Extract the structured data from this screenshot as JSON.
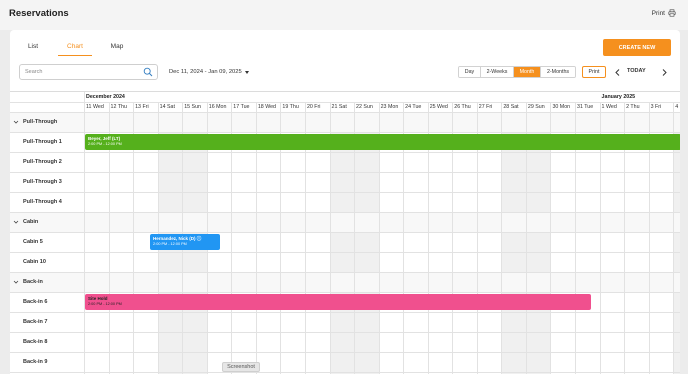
{
  "app": {
    "title": "Reservations",
    "print_label": "Print"
  },
  "tabs": [
    {
      "label": "List"
    },
    {
      "label": "Chart"
    },
    {
      "label": "Map"
    }
  ],
  "create_button": "CREATE NEW",
  "search": {
    "placeholder": "Search",
    "value": ""
  },
  "date_range": "Dec 11, 2024 - Jan 09, 2025",
  "view_buttons": [
    {
      "label": "Day"
    },
    {
      "label": "2-Weeks"
    },
    {
      "label": "Month"
    },
    {
      "label": "2-Months"
    }
  ],
  "active_view": "Month",
  "print_button": "Print",
  "today_button": "TODAY",
  "timeline": {
    "months": [
      {
        "label": "December 2024",
        "start_index": 0
      },
      {
        "label": "January 2025",
        "start_index": 21
      }
    ],
    "days": [
      "11 Wed",
      "12 Thu",
      "13 Fri",
      "14 Sat",
      "15 Sun",
      "16 Mon",
      "17 Tue",
      "18 Wed",
      "19 Thu",
      "20 Fri",
      "21 Sat",
      "22 Sun",
      "23 Mon",
      "24 Tue",
      "25 Wed",
      "26 Thu",
      "27 Fri",
      "28 Sat",
      "29 Sun",
      "30 Mon",
      "31 Tue",
      "1 Wed",
      "2 Thu",
      "3 Fri",
      "4"
    ],
    "weekend_indices": [
      3,
      4,
      10,
      11,
      17,
      18,
      24
    ]
  },
  "rows": [
    {
      "type": "group",
      "label": "Pull-Through"
    },
    {
      "type": "site",
      "label": "Pull-Through 1"
    },
    {
      "type": "site",
      "label": "Pull-Through 2"
    },
    {
      "type": "site",
      "label": "Pull-Through 3"
    },
    {
      "type": "site",
      "label": "Pull-Through 4"
    },
    {
      "type": "group",
      "label": "Cabin"
    },
    {
      "type": "site",
      "label": "Cabin 5"
    },
    {
      "type": "site",
      "label": "Cabin 10"
    },
    {
      "type": "group",
      "label": "Back-in"
    },
    {
      "type": "site",
      "label": "Back-in 6"
    },
    {
      "type": "site",
      "label": "Back-in 7"
    },
    {
      "type": "site",
      "label": "Back-in 8"
    },
    {
      "type": "site",
      "label": "Back-in 9"
    }
  ],
  "bookings": [
    {
      "row": 1,
      "name": "Beyer, Jeff (LT)",
      "time": "2:00 PM - 12:00 PM",
      "start_day": 0,
      "end_day": 24.3,
      "color": "#55b01c",
      "text_color": "#ffffff"
    },
    {
      "row": 6,
      "name": "Hernandez, Nick (D) ⓘ",
      "time": "2:00 PM - 12:00 PM",
      "start_day": 2.65,
      "end_day": 5.55,
      "color": "#2196f3",
      "text_color": "#ffffff"
    },
    {
      "row": 9,
      "name": "Site Hold",
      "time": "2:00 PM - 12:00 PM",
      "start_day": 0,
      "end_day": 20.65,
      "color": "#f0508e",
      "text_color": "#222222"
    }
  ],
  "screenshot_tag": "Screenshot",
  "colors": {
    "accent": "#f5901e"
  }
}
